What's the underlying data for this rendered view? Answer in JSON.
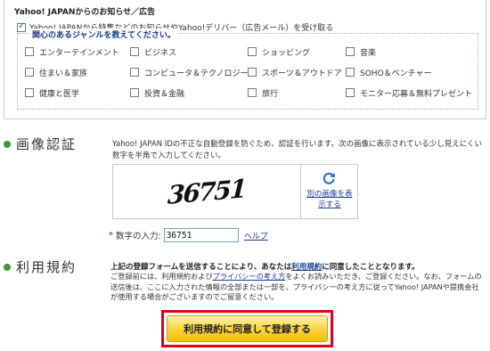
{
  "newsletter": {
    "title": "Yahoo! JAPANからのお知らせ／広告",
    "optin_label": "Yahoo! JAPANから特集などのお知らせやYahoo!デリバー（広告メール）を受け取る",
    "optin_checked": true,
    "genre_title": "関心のあるジャンルを教えてください。",
    "genres": [
      "エンターテインメント",
      "ビジネス",
      "ショッピング",
      "音楽",
      "住まい＆家族",
      "コンピュータ＆テクノロジー",
      "スポーツ＆アウトドア",
      "SOHO＆ベンチャー",
      "健康と医学",
      "投資＆金融",
      "旅行",
      "モニター応募＆無料プレゼント"
    ]
  },
  "captcha": {
    "section_title": "画像認証",
    "description": "Yahoo! JAPAN IDの不正な自動登録を防ぐため、認証を行います。次の画像に表示されている少し見えにくい数字を半角で入力してください。",
    "image_text": "36751",
    "refresh_label": "別の画像を表示する",
    "input_label": "数字の入力:",
    "input_value": "36751",
    "help_label": "ヘルプ"
  },
  "terms": {
    "section_title": "利用規約",
    "lead_before": "上記の登録フォームを送信することにより、あなたは",
    "lead_link": "利用規約",
    "lead_after": "に同意したこととなります。",
    "body_1": "ご登録前には、利用規約および",
    "body_link": "プライバシーの考え方",
    "body_2": "をよくお読みいただき、ご登録ください。なお、フォームの送信後は、ここに入力された情報の全部または一部を、プライバシーの考え方に従ってYahoo! JAPANや提携会社が使用する場合がございますのでご留意ください。"
  },
  "submit": {
    "label": "利用規約に同意して登録する"
  }
}
